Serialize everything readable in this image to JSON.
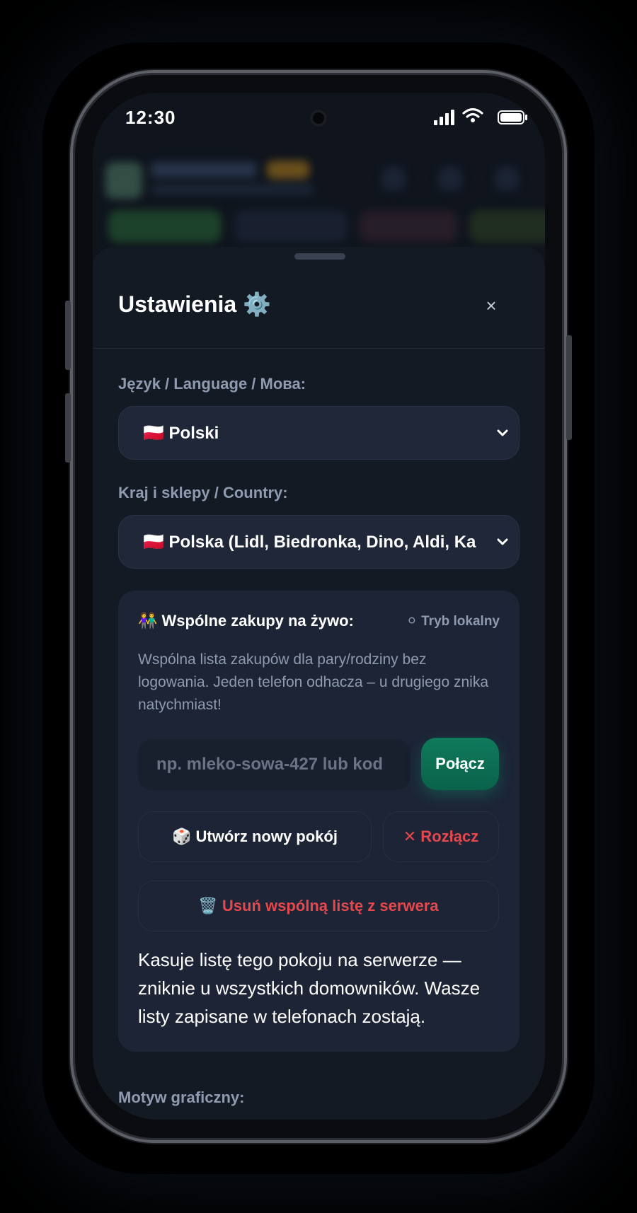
{
  "status_bar": {
    "time": "12:30"
  },
  "settings": {
    "title": "Ustawienia ⚙️",
    "close_glyph": "×",
    "language": {
      "label": "Język / Language / Мова:",
      "value": "🇵🇱 Polski"
    },
    "country": {
      "label": "Kraj i sklepy / Country:",
      "value": "🇵🇱 Polska (Lidl, Biedronka, Dino, Aldi, Ka"
    },
    "shared": {
      "title": "👫 Wspólne zakupy na żywo:",
      "mode": "⚪ Tryb lokalny",
      "description": "Wspólna lista zakupów dla pary/rodziny bez logowania. Jeden telefon odhacza – u drugiego znika natychmiast!",
      "room_placeholder": "np. mleko-sowa-427 lub kod",
      "connect_label": "Połącz",
      "create_room_label": "🎲 Utwórz nowy pokój",
      "disconnect_label": "✕ Rozłącz",
      "delete_label": "🗑️ Usuń wspólną listę z serwera",
      "delete_note": "Kasuje listę tego pokoju na serwerze — zniknie u wszystkich domowników. Wasze listy zapisane w telefonach zostają."
    },
    "theme_label": "Motyw graficzny:"
  },
  "colors": {
    "accent_green": "#0f7a5b",
    "danger_red": "#e5484d",
    "sheet_bg": "#141a24",
    "card_bg": "#1c2436"
  }
}
